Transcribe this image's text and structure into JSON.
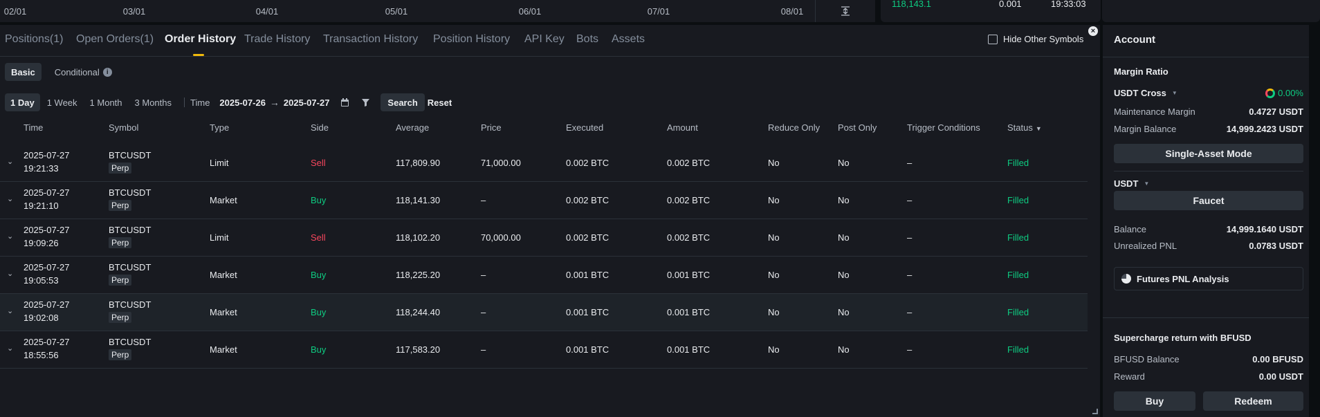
{
  "chart_axis": [
    "02/01",
    "03/01",
    "04/01",
    "05/01",
    "06/01",
    "07/01",
    "08/01"
  ],
  "trades_strip": {
    "price": "118,143.1",
    "qty": "0.001",
    "time": "19:33:03"
  },
  "tabs": [
    "Positions(1)",
    "Open Orders(1)",
    "Order History",
    "Trade History",
    "Transaction History",
    "Position History",
    "API Key",
    "Bots",
    "Assets"
  ],
  "hide_other_symbols": "Hide Other Symbols",
  "subtabs": {
    "basic": "Basic",
    "conditional": "Conditional",
    "info_glyph": "i"
  },
  "filters": {
    "ranges": [
      "1 Day",
      "1 Week",
      "1 Month",
      "3 Months"
    ],
    "time_label": "Time",
    "from": "2025-07-26",
    "arrow": "→",
    "to": "2025-07-27",
    "search": "Search",
    "reset": "Reset"
  },
  "columns": [
    "Time",
    "Symbol",
    "Type",
    "Side",
    "Average",
    "Price",
    "Executed",
    "Amount",
    "Reduce Only",
    "Post Only",
    "Trigger Conditions",
    "Status"
  ],
  "orders": [
    {
      "date": "2025-07-27",
      "time": "19:21:33",
      "symbol": "BTCUSDT",
      "perp": "Perp",
      "type": "Limit",
      "side": "Sell",
      "average": "117,809.90",
      "price": "71,000.00",
      "executed": "0.002 BTC",
      "amount": "0.002 BTC",
      "reduce_only": "No",
      "post_only": "No",
      "trigger": "–",
      "status": "Filled"
    },
    {
      "date": "2025-07-27",
      "time": "19:21:10",
      "symbol": "BTCUSDT",
      "perp": "Perp",
      "type": "Market",
      "side": "Buy",
      "average": "118,141.30",
      "price": "–",
      "executed": "0.002 BTC",
      "amount": "0.002 BTC",
      "reduce_only": "No",
      "post_only": "No",
      "trigger": "–",
      "status": "Filled"
    },
    {
      "date": "2025-07-27",
      "time": "19:09:26",
      "symbol": "BTCUSDT",
      "perp": "Perp",
      "type": "Limit",
      "side": "Sell",
      "average": "118,102.20",
      "price": "70,000.00",
      "executed": "0.002 BTC",
      "amount": "0.002 BTC",
      "reduce_only": "No",
      "post_only": "No",
      "trigger": "–",
      "status": "Filled"
    },
    {
      "date": "2025-07-27",
      "time": "19:05:53",
      "symbol": "BTCUSDT",
      "perp": "Perp",
      "type": "Market",
      "side": "Buy",
      "average": "118,225.20",
      "price": "–",
      "executed": "0.001 BTC",
      "amount": "0.001 BTC",
      "reduce_only": "No",
      "post_only": "No",
      "trigger": "–",
      "status": "Filled"
    },
    {
      "date": "2025-07-27",
      "time": "19:02:08",
      "symbol": "BTCUSDT",
      "perp": "Perp",
      "type": "Market",
      "side": "Buy",
      "average": "118,244.40",
      "price": "–",
      "executed": "0.001 BTC",
      "amount": "0.001 BTC",
      "reduce_only": "No",
      "post_only": "No",
      "trigger": "–",
      "status": "Filled"
    },
    {
      "date": "2025-07-27",
      "time": "18:55:56",
      "symbol": "BTCUSDT",
      "perp": "Perp",
      "type": "Market",
      "side": "Buy",
      "average": "117,583.20",
      "price": "–",
      "executed": "0.001 BTC",
      "amount": "0.001 BTC",
      "reduce_only": "No",
      "post_only": "No",
      "trigger": "–",
      "status": "Filled"
    }
  ],
  "account": {
    "title": "Account",
    "margin_ratio_label": "Margin Ratio",
    "margin_mode": "USDT Cross",
    "margin_ratio_value": "0.00%",
    "maintenance_margin_label": "Maintenance Margin",
    "maintenance_margin": "0.4727 USDT",
    "margin_balance_label": "Margin Balance",
    "margin_balance": "14,999.2423 USDT",
    "single_asset_mode": "Single-Asset Mode",
    "asset": "USDT",
    "faucet": "Faucet",
    "balance_label": "Balance",
    "balance": "14,999.1640 USDT",
    "unrealized_pnl_label": "Unrealized PNL",
    "unrealized_pnl": "0.0783 USDT",
    "futures_pnl_analysis": "Futures PNL Analysis",
    "supercharge_title": "Supercharge return with BFUSD",
    "bfusd_balance_label": "BFUSD Balance",
    "bfusd_balance": "0.00 BFUSD",
    "reward_label": "Reward",
    "reward": "0.00 USDT",
    "buy": "Buy",
    "redeem": "Redeem"
  },
  "colors": {
    "sell": "#f6465d",
    "buy": "#0ecb81",
    "accent": "#f0b90b",
    "panel": "#181a20"
  }
}
